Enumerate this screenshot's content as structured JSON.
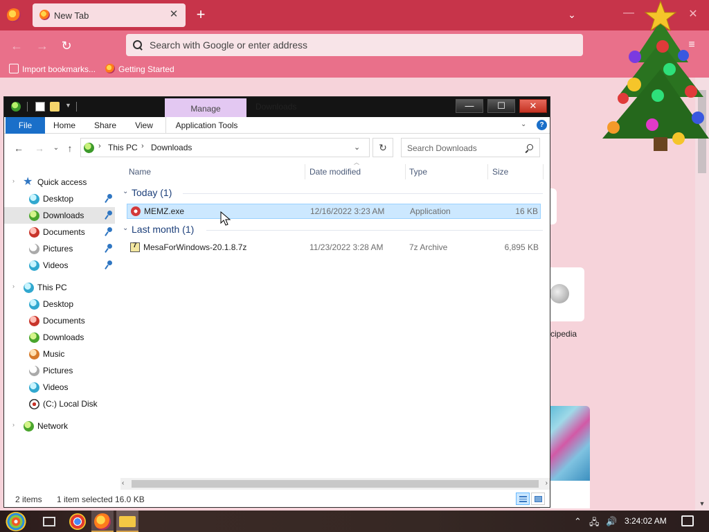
{
  "browser": {
    "tab_title": "New Tab",
    "tab_close": "✕",
    "new_tab": "+",
    "list_tabs": "⌄",
    "minimize": "—",
    "close": "✕",
    "back": "←",
    "forward": "→",
    "reload": "↻",
    "url_placeholder": "Search with Google or enter address",
    "menu": "≡",
    "bookmarks": [
      {
        "label": "Import bookmarks..."
      },
      {
        "label": "Getting Started"
      }
    ],
    "background_tile_label": "cipedia",
    "colors": {
      "tabbar": "#c7344a",
      "toolbar": "#e9708a",
      "page": "#f6d3da"
    }
  },
  "explorer": {
    "manage_tab": "Manage",
    "window_title": "Downloads",
    "window_buttons": {
      "minimize": "—",
      "maximize": "☐",
      "close": "✕"
    },
    "ribbon_tabs": [
      "File",
      "Home",
      "Share",
      "View",
      "Application Tools"
    ],
    "ribbon_collapse": "⌄",
    "help": "?",
    "nav_buttons": {
      "back": "←",
      "forward": "→",
      "recent": "⌄",
      "up": "↑"
    },
    "breadcrumb": [
      "This PC",
      "Downloads"
    ],
    "breadcrumb_sep": "›",
    "address_dropdown": "⌄",
    "refresh": "↻",
    "search_placeholder": "Search Downloads",
    "nav_pane": {
      "quick_access": {
        "label": "Quick access",
        "items": [
          "Desktop",
          "Downloads",
          "Documents",
          "Pictures",
          "Videos"
        ]
      },
      "this_pc": {
        "label": "This PC",
        "items": [
          "Desktop",
          "Documents",
          "Downloads",
          "Music",
          "Pictures",
          "Videos",
          "(C:) Local Disk"
        ]
      },
      "network": {
        "label": "Network"
      }
    },
    "columns": [
      "Name",
      "Date modified",
      "Type",
      "Size"
    ],
    "sort_arrow": "︿",
    "groups": [
      {
        "label": "Today (1)",
        "files": [
          {
            "name": "MEMZ.exe",
            "date": "12/16/2022 3:23 AM",
            "type": "Application",
            "size": "16 KB",
            "selected": true
          }
        ]
      },
      {
        "label": "Last month (1)",
        "files": [
          {
            "name": "MesaForWindows-20.1.8.7z",
            "date": "11/23/2022 3:28 AM",
            "type": "7z Archive",
            "size": "6,895 KB",
            "selected": false
          }
        ]
      }
    ],
    "group_chevron": "⌄",
    "tree_chevron": "›",
    "scroll_left": "‹",
    "scroll_right": "›",
    "status": {
      "items": "2 items",
      "selected": "1 item selected",
      "size": "16.0 KB"
    },
    "accent": "#1a6fc9",
    "selection_color": "#cce8ff"
  },
  "taskbar": {
    "clock": "3:24:02 AM",
    "tray": [
      "⌃",
      "🖧",
      "🔊"
    ]
  }
}
